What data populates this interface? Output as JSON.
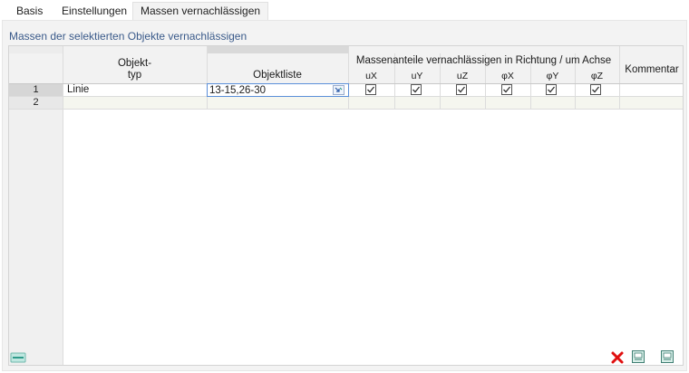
{
  "tabs": [
    {
      "label": "Basis",
      "active": false
    },
    {
      "label": "Einstellungen",
      "active": false
    },
    {
      "label": "Massen vernachlässigen",
      "active": true
    }
  ],
  "panel": {
    "title": "Massen der selektierten Objekte vernachlässigen"
  },
  "table": {
    "headers": {
      "objekt_typ_line1": "Objekt-",
      "objekt_typ_line2": "typ",
      "objektliste": "Objektliste",
      "group": "Massenanteile vernachlässigen in Richtung / um Achse",
      "ux": "uX",
      "uy": "uY",
      "uz": "uZ",
      "phix": "φX",
      "phiy": "φY",
      "phiz": "φZ",
      "kommentar": "Kommentar"
    },
    "rows": [
      {
        "num": "1",
        "objekt_typ": "Linie",
        "objektliste": "13-15,26-30",
        "ux": true,
        "uy": true,
        "uz": true,
        "phix": true,
        "phiy": true,
        "phiz": true,
        "kommentar": ""
      },
      {
        "num": "2",
        "objekt_typ": "",
        "objektliste": "",
        "kommentar": ""
      }
    ]
  },
  "toolbar": {
    "left_icon": "table-settings-icon",
    "right_icons": [
      "delete-icon",
      "import-icon",
      "export-icon"
    ]
  },
  "colors": {
    "panel_bg": "#f3f3f3",
    "title_blue": "#3a5a8a",
    "delete_red": "#e01010",
    "accent_teal": "#2e9b8a"
  }
}
